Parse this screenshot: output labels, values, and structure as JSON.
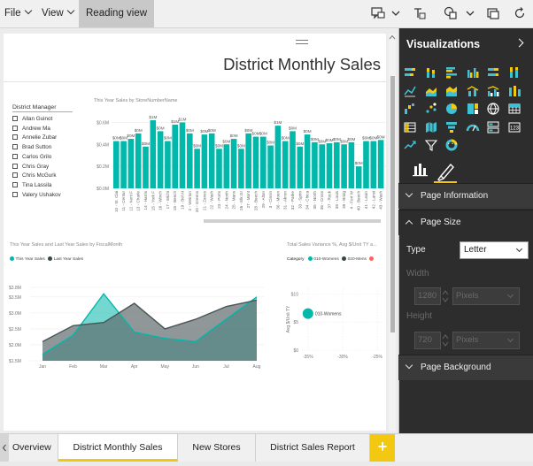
{
  "menubar": {
    "file_label": "File",
    "view_label": "View",
    "reading_view_label": "Reading view",
    "tool_icons": [
      "comment-bubble-icon",
      "text-box-icon",
      "shapes-icon",
      "page-view-icon",
      "refresh-icon"
    ]
  },
  "report": {
    "title": "District Monthly Sales"
  },
  "slicer": {
    "title": "District Manager",
    "items": [
      "Allan Guinot",
      "Andrew Ma",
      "Annelie Zubar",
      "Brad Sutton",
      "Carlos Grilo",
      "Chris Gray",
      "Chris McGurk",
      "Tina Lassila",
      "Valery Ushakov"
    ]
  },
  "chart_data": [
    {
      "type": "bar",
      "title": "This Year Sales by StoreNumberName",
      "y_ticks": [
        "$0.6M",
        "$0.4M",
        "$0.2M",
        "$0.0M"
      ],
      "ylim": [
        0,
        0.7
      ],
      "bar_color": "#01b8aa",
      "data_labels": [
        "$0M",
        "$0M",
        "$0M",
        "$0M",
        "$0M",
        "$1M",
        "$0M",
        "$0M",
        "$1M",
        "$1M",
        "$0M",
        "$0M",
        "$0M",
        "$0M",
        "$0M",
        "$0M",
        "$0M",
        "$0M",
        "$0M",
        "$0M",
        "$0M",
        "$0M",
        "$1M",
        "$0M",
        "$0M",
        "$0M",
        "$0M",
        "$0M",
        "$0M",
        "$0M",
        "$0M",
        "$0M",
        "$0M",
        "$0M",
        "$0M",
        "$0M",
        "$0M"
      ],
      "values": [
        0.43,
        0.43,
        0.45,
        0.5,
        0.38,
        0.62,
        0.52,
        0.43,
        0.58,
        0.6,
        0.5,
        0.36,
        0.49,
        0.5,
        0.36,
        0.4,
        0.45,
        0.36,
        0.5,
        0.47,
        0.47,
        0.39,
        0.57,
        0.43,
        0.52,
        0.38,
        0.49,
        0.42,
        0.4,
        0.41,
        0.42,
        0.4,
        0.42,
        0.2,
        0.43,
        0.43,
        0.44
      ],
      "categories": [
        "10 - St. Clai",
        "11 - Centur",
        "12 - Kent F",
        "13 - Charle",
        "14 - Harris",
        "15 - York F",
        "16 - Winch",
        "17 - Wichi",
        "18 - Beech",
        "19 - Bel Ai",
        "2 - Weirton",
        "20 - Greens",
        "21 - Zanes",
        "22 - Wash",
        "23 - Ports",
        "24 - North",
        "25 - Mans",
        "26 - Elk Gr",
        "27 - Mont",
        "28 - Beech",
        "29 - Alton",
        "3 - Cincin",
        "30 - Moun",
        "31 - Akron",
        "32 - Parke",
        "33 - Sprin",
        "34 - Chica",
        "35 - North",
        "36 - Cross",
        "37 - Rock",
        "38 - Louis",
        "39 - Bridg",
        "4 - Fort W",
        "40 - Beech",
        "41 - Lexin",
        "42 - Lansi",
        "43 - Wash"
      ]
    },
    {
      "type": "area",
      "title": "This Year Sales and Last Year Sales by FiscalMonth",
      "series": [
        {
          "name": "This Year Sales",
          "color": "#01b8aa",
          "values": [
            1.7,
            2.3,
            3.6,
            2.4,
            2.2,
            2.1,
            2.8,
            3.5
          ]
        },
        {
          "name": "Last Year Sales",
          "color": "#5f6b6d",
          "values": [
            2.1,
            2.6,
            2.7,
            3.3,
            2.5,
            2.8,
            3.2,
            3.4
          ]
        }
      ],
      "categories": [
        "Jan",
        "Feb",
        "Mar",
        "Apr",
        "May",
        "Jun",
        "Jul",
        "Aug"
      ],
      "y_ticks": [
        "$3.8M",
        "$3.5M",
        "$3.0M",
        "$2.5M",
        "$2.0M",
        "$1.5M"
      ],
      "ylim": [
        1.5,
        3.8
      ]
    },
    {
      "type": "scatter",
      "title": "Total Sales Variance %, Avg $/Unit TY a...",
      "legend_title": "Category",
      "legend": [
        {
          "name": "010-Womens",
          "color": "#01b8aa"
        },
        {
          "name": "020-Mens",
          "color": "#374649"
        },
        {
          "name": "",
          "color": "#fd625e"
        }
      ],
      "ylabel": "Avg $/Unit TY",
      "y_ticks": [
        "$10",
        "$5",
        "$0"
      ],
      "x_ticks": [
        "-35%",
        "-30%",
        "-25%"
      ],
      "xlim": [
        -36,
        -24
      ],
      "ylim": [
        0,
        11
      ],
      "points": [
        {
          "name": "010-Womens",
          "x": -35,
          "y": 6.5,
          "label": "010-Womens"
        }
      ]
    }
  ],
  "visualizations": {
    "title": "Visualizations",
    "icons": [
      "stacked-bar-icon",
      "stacked-column-icon",
      "clustered-bar-icon",
      "clustered-column-icon",
      "100-stacked-bar-icon",
      "100-stacked-column-icon",
      "line-chart-icon",
      "area-chart-icon",
      "stacked-area-icon",
      "line-column-icon",
      "line-clustered-column-icon",
      "ribbon-chart-icon",
      "waterfall-icon",
      "scatter-icon",
      "pie-chart-icon",
      "treemap-icon",
      "map-icon",
      "table-icon",
      "matrix-icon",
      "filled-map-icon",
      "funnel-icon",
      "gauge-icon",
      "multirow-card-icon",
      "card-icon",
      "kpi-icon",
      "slicer-icon",
      "donut-chart-icon",
      "more-options-icon"
    ],
    "ellipsis": "...",
    "fields_tab_icon": "fields-icon",
    "format_tab_icon": "paint-roller-icon"
  },
  "format": {
    "page_information": "Page Information",
    "page_size": "Page Size",
    "type_label": "Type",
    "type_value": "Letter",
    "width_label": "Width",
    "width_value": "1280",
    "width_unit": "Pixels",
    "height_label": "Height",
    "height_value": "720",
    "height_unit": "Pixels",
    "page_background": "Page Background"
  },
  "tabs": {
    "overview": "Overview",
    "district_monthly_sales": "District Monthly Sales",
    "new_stores": "New Stores",
    "district_sales_report": "District Sales Report",
    "add": "+"
  },
  "colors": {
    "accent": "#f2c811",
    "teal": "#01b8aa",
    "dark_grey": "#5f6b6d",
    "panel": "#2d2d2d"
  }
}
